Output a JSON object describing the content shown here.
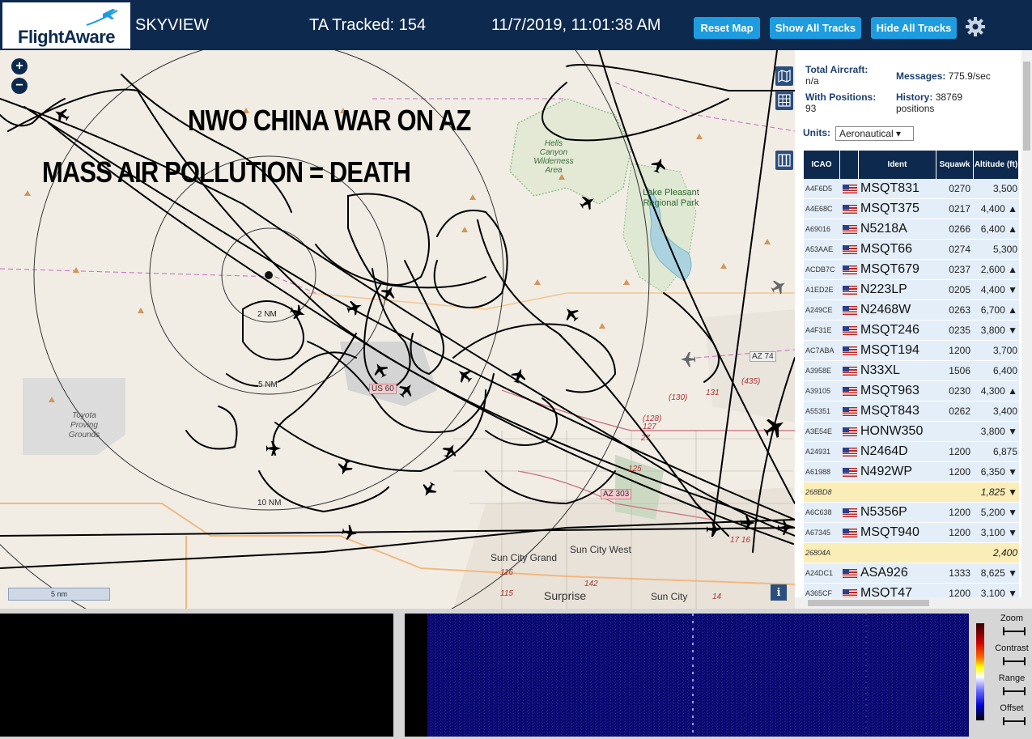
{
  "header": {
    "logo_text": "FlightAware",
    "app_name": "SKYVIEW",
    "ta_tracked": "TA Tracked: 154",
    "timestamp": "11/7/2019, 11:01:38 AM",
    "buttons": {
      "reset": "Reset Map",
      "show_all": "Show All Tracks",
      "hide_all": "Hide All Tracks"
    },
    "settings_icon": "gear-icon",
    "brand_color": "#0d2a4e",
    "button_color": "#1e9ce0"
  },
  "map": {
    "overlay_line1": "NWO CHINA WAR ON AZ",
    "overlay_line2": "MASS AIR POLLUTION = DEATH",
    "zoom_in": "+",
    "zoom_out": "−",
    "scale_label": "5 nm",
    "info_label": "i",
    "range_rings": {
      "r2": "2 NM",
      "r5": "5 NM",
      "r10": "10 NM"
    },
    "labels": {
      "hells_canyon": "Hells Canyon Wilderness Area",
      "lake_pleasant": "Lake Pleasant Regional Park",
      "toyota": "Toyota Proving Grounds",
      "sun_city_grand": "Sun City Grand",
      "sun_city_west": "Sun City West",
      "surprise": "Surprise",
      "sun_city": "Sun City",
      "az74": "AZ 74",
      "az303": "AZ 303",
      "us60": "US 60",
      "r130": "(130)",
      "r131": "131",
      "r128": "(128)",
      "r127": "127",
      "r27": "27",
      "r125": "125",
      "r435": "(435)",
      "r116": "116",
      "r115": "115",
      "r142": "142",
      "r14": "14",
      "r1716": "17 16"
    },
    "tool_icons": [
      "map-layers-icon",
      "grid-icon",
      "columns-icon"
    ]
  },
  "panel": {
    "total_aircraft_label": "Total Aircraft:",
    "total_aircraft_value": "n/a",
    "with_positions_label": "With Positions:",
    "with_positions_value": "93",
    "messages_label": "Messages:",
    "messages_value": "775.9/sec",
    "history_label": "History:",
    "history_value": "38769",
    "history_unit": "positions",
    "units_label": "Units:",
    "units_value": "Aeronautical",
    "columns": {
      "icao": "ICAO",
      "flag": "",
      "ident": "Ident",
      "squawk": "Squawk",
      "altitude": "Altitude (ft)"
    },
    "rows": [
      {
        "icao": "A4F6D5",
        "ident": "MSQT831",
        "squawk": "0270",
        "alt": "3,500",
        "flag": true
      },
      {
        "icao": "A4E68C",
        "ident": "MSQT375",
        "squawk": "0217",
        "alt": "4,400 ▲",
        "flag": true
      },
      {
        "icao": "A69016",
        "ident": "N5218A",
        "squawk": "0266",
        "alt": "6,400 ▲",
        "flag": true
      },
      {
        "icao": "A53AAE",
        "ident": "MSQT66",
        "squawk": "0274",
        "alt": "5,300",
        "flag": true
      },
      {
        "icao": "ACDB7C",
        "ident": "MSQT679",
        "squawk": "0237",
        "alt": "2,600 ▲",
        "flag": true
      },
      {
        "icao": "A1ED2E",
        "ident": "N223LP",
        "squawk": "0205",
        "alt": "4,400 ▼",
        "flag": true
      },
      {
        "icao": "A249CE",
        "ident": "N2468W",
        "squawk": "0263",
        "alt": "6,700 ▲",
        "flag": true
      },
      {
        "icao": "A4F31E",
        "ident": "MSQT246",
        "squawk": "0235",
        "alt": "3,800 ▼",
        "flag": true
      },
      {
        "icao": "AC7ABA",
        "ident": "MSQT194",
        "squawk": "1200",
        "alt": "3,700",
        "flag": true
      },
      {
        "icao": "A3958E",
        "ident": "N33XL",
        "squawk": "1506",
        "alt": "6,400",
        "flag": true
      },
      {
        "icao": "A39105",
        "ident": "MSQT963",
        "squawk": "0230",
        "alt": "4,300 ▲",
        "flag": true
      },
      {
        "icao": "A55351",
        "ident": "MSQT843",
        "squawk": "0262",
        "alt": "3,400",
        "flag": true
      },
      {
        "icao": "A3E54E",
        "ident": "HONW350",
        "squawk": "",
        "alt": "3,800 ▼",
        "flag": true
      },
      {
        "icao": "A24931",
        "ident": "N2464D",
        "squawk": "1200",
        "alt": "6,875",
        "flag": true
      },
      {
        "icao": "A61988",
        "ident": "N492WP",
        "squawk": "1200",
        "alt": "6,350 ▼",
        "flag": true
      },
      {
        "icao": "268BD8",
        "ident": "",
        "squawk": "",
        "alt": "1,825 ▼",
        "flag": false
      },
      {
        "icao": "A6C638",
        "ident": "N5356P",
        "squawk": "1200",
        "alt": "5,200 ▼",
        "flag": true
      },
      {
        "icao": "A67345",
        "ident": "MSQT940",
        "squawk": "1200",
        "alt": "3,100 ▼",
        "flag": true
      },
      {
        "icao": "26804A",
        "ident": "",
        "squawk": "",
        "alt": "2,400",
        "flag": false
      },
      {
        "icao": "A24DC1",
        "ident": "ASA926",
        "squawk": "1333",
        "alt": "8,625 ▼",
        "flag": true
      },
      {
        "icao": "A365CF",
        "ident": "MSQT47",
        "squawk": "1200",
        "alt": "3,100 ▼",
        "flag": true
      }
    ]
  },
  "bottom": {
    "controls": [
      "Zoom",
      "Contrast",
      "Range",
      "Offset"
    ]
  }
}
